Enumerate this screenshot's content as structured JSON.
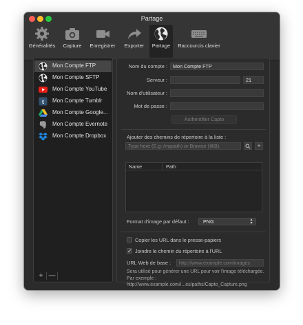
{
  "window": {
    "title": "Partage"
  },
  "toolbar": {
    "items": [
      {
        "label": "Généralités",
        "icon": "gear-icon"
      },
      {
        "label": "Capture",
        "icon": "camera-icon"
      },
      {
        "label": "Enregistrer",
        "icon": "video-camera-icon"
      },
      {
        "label": "Exporter",
        "icon": "share-arrow-icon"
      },
      {
        "label": "Partage",
        "icon": "globe-icon",
        "selected": true
      },
      {
        "label": "Raccourcis clavier",
        "icon": "keyboard-icon"
      }
    ]
  },
  "sidebar": {
    "accounts": [
      {
        "label": "Mon Compte FTP",
        "icon": "globe-icon",
        "selected": true
      },
      {
        "label": "Mon Compte SFTP",
        "icon": "globe-icon"
      },
      {
        "label": "Mon Compte YouTube",
        "icon": "youtube-icon"
      },
      {
        "label": "Mon Compte Tumblr",
        "icon": "tumblr-icon"
      },
      {
        "label": "Mon Compte Google...",
        "icon": "google-drive-icon"
      },
      {
        "label": "Mon Compte Evernote",
        "icon": "evernote-icon"
      },
      {
        "label": "Mon Compte Dropbox",
        "icon": "dropbox-icon"
      }
    ],
    "add_label": "+",
    "remove_label": "—"
  },
  "form": {
    "account_name_label": "Nom du compte :",
    "account_name_value": "Mon Compte FTP",
    "server_label": "Serveur :",
    "server_value": "",
    "port_value": "21",
    "username_label": "Nom d'utilisateur :",
    "username_value": "",
    "password_label": "Mot de passe :",
    "password_value": "",
    "authenticate_button": "Authentifier Capto",
    "paths_label": "Ajouter des chemins de répertoire à la liste :",
    "path_placeholder": "Type here (E.g: /mypath) or Browse (⌘B)",
    "table_headers": [
      "Name",
      "Path"
    ],
    "image_format_label": "Format d'image par défaut :",
    "image_format_value": "PNG",
    "copy_url_label": "Copier les URL dans le presse-papiers",
    "copy_url_checked": false,
    "join_path_label": "Joindre le chemin du répertoire à l'URL",
    "join_path_checked": true,
    "base_url_label": "URL Web de base :",
    "base_url_placeholder": "http://www.example.com/images",
    "help_text": "Sera utilisé pour générer une URL pour voir l'image téléchargée. Par exemple :",
    "help_example": "http://www.example.com/i...es/paths/Capto_Capture.png"
  },
  "colors": {
    "close": "#fe5f57",
    "minimize": "#febc2e",
    "zoom": "#28c840"
  }
}
